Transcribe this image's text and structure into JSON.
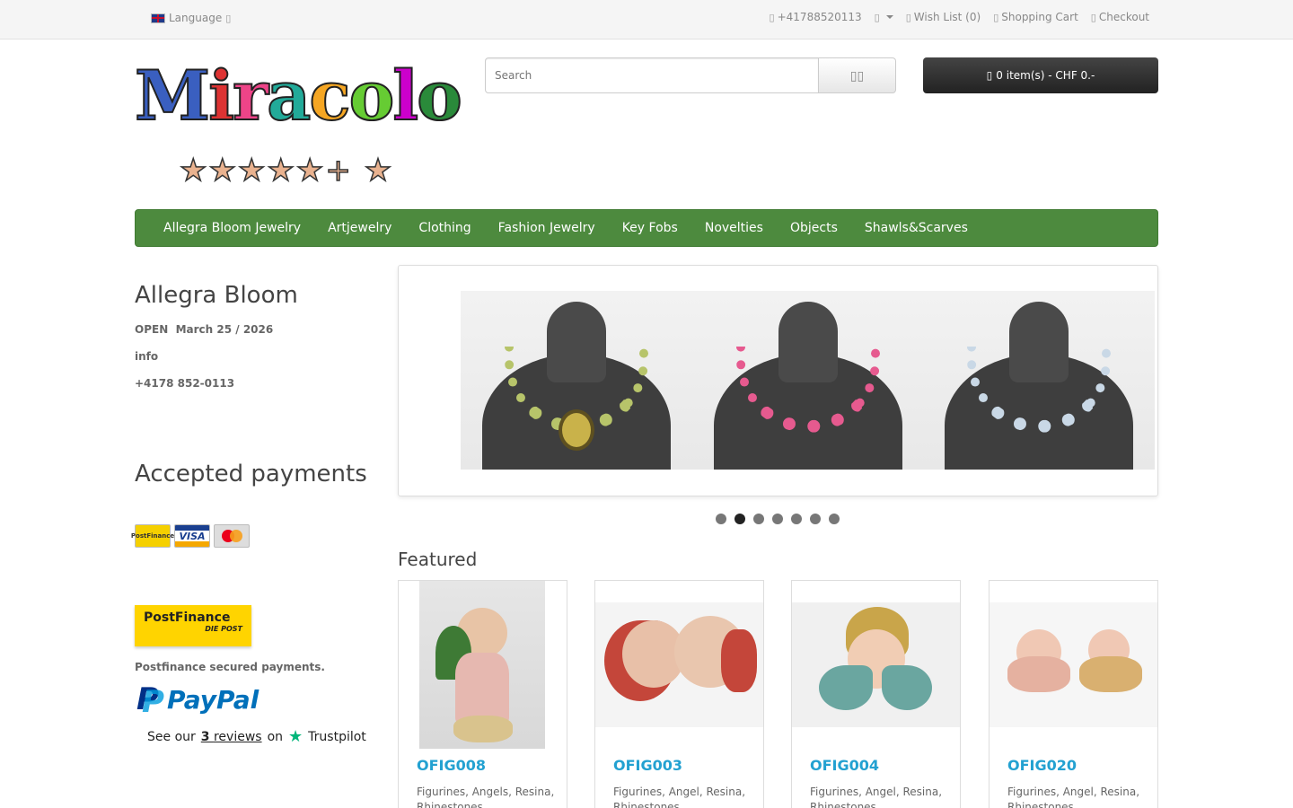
{
  "topbar": {
    "language_label": "Language",
    "phone": "+41788520113",
    "wishlist": "Wish List (0)",
    "shopping_cart": "Shopping Cart",
    "checkout": "Checkout"
  },
  "header": {
    "logo_text": "Miracolo",
    "stars_text": "★★★★★+ ★",
    "search_placeholder": "Search",
    "cart_label": "0 item(s) - CHF 0.-"
  },
  "menu": {
    "items": [
      "Allegra Bloom Jewelry",
      "Artjewelry",
      "Clothing",
      "Fashion Jewelry",
      "Key Fobs",
      "Novelties",
      "Objects",
      "Shawls&Scarves"
    ]
  },
  "sidebar": {
    "store_title": "Allegra Bloom",
    "open_line": "OPEN  March 25 / 2026",
    "info_line": "info",
    "phone_line": "+4178 852-0113",
    "payments_title": "Accepted payments",
    "postfinance_logo": "PostFinance",
    "postfinance_sub": "DIE POST",
    "postfinance_text": "Postfinance secured payments.",
    "paypal_text": "PayPal",
    "trustpilot": {
      "prefix": "See our",
      "count": "3",
      "reviews": "reviews",
      "on": "on",
      "brand": "Trustpilot"
    }
  },
  "slider": {
    "dot_count": 7,
    "active_dot": 1
  },
  "featured": {
    "title": "Featured",
    "products": [
      {
        "code": "OFIG008",
        "desc": "Figurines, Angels, Resina, Rhinestones"
      },
      {
        "code": "OFIG003",
        "desc": "Figurines, Angel, Resina, Rhinestones"
      },
      {
        "code": "OFIG004",
        "desc": "Figurines, Angel, Resina, Rhinestones"
      },
      {
        "code": "OFIG020",
        "desc": "Figurines, Angel, Resina, Rhinestones"
      }
    ]
  },
  "colors": {
    "menu_green": "#4d8a3e",
    "product_link": "#23a1d1",
    "cart_dark": "#333333"
  }
}
